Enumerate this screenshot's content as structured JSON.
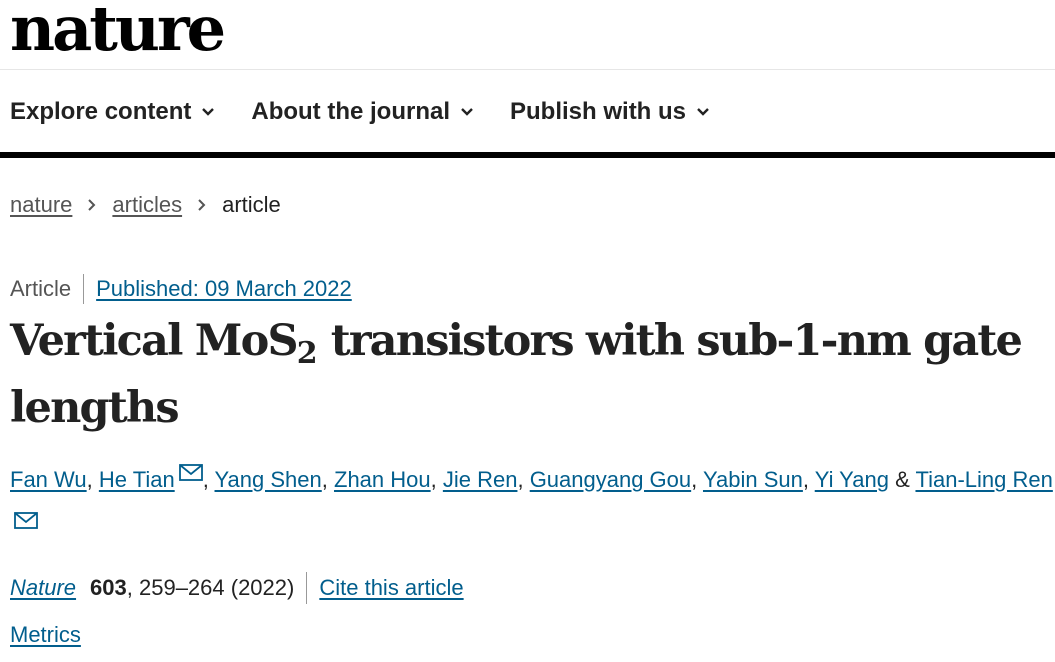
{
  "logo": "nature",
  "nav": [
    {
      "label": "Explore content"
    },
    {
      "label": "About the journal"
    },
    {
      "label": "Publish with us"
    }
  ],
  "breadcrumb": [
    "nature",
    "articles",
    "article"
  ],
  "article": {
    "type": "Article",
    "published": "Published: 09 March 2022",
    "title_pre": "Vertical MoS",
    "title_sub": "2",
    "title_post": " transistors with sub-1-nm gate lengths",
    "authors": [
      "Fan Wu",
      "He Tian",
      "Yang Shen",
      "Zhan Hou",
      "Jie Ren",
      "Guangyang Gou",
      "Yabin Sun",
      "Yi Yang",
      "Tian-Ling Ren"
    ],
    "and": "&",
    "journal": "Nature",
    "volume": "603",
    "pages": ", 259–264 (2022)",
    "cite_label": "Cite this article",
    "metrics_label": "Metrics"
  },
  "icons": {
    "nav_chevron": "chevron-down-icon",
    "breadcrumb_sep": "chevron-right-icon",
    "mail": "mail-icon"
  },
  "colors": {
    "link": "#025e8d",
    "text": "#222222",
    "muted": "#555555"
  }
}
